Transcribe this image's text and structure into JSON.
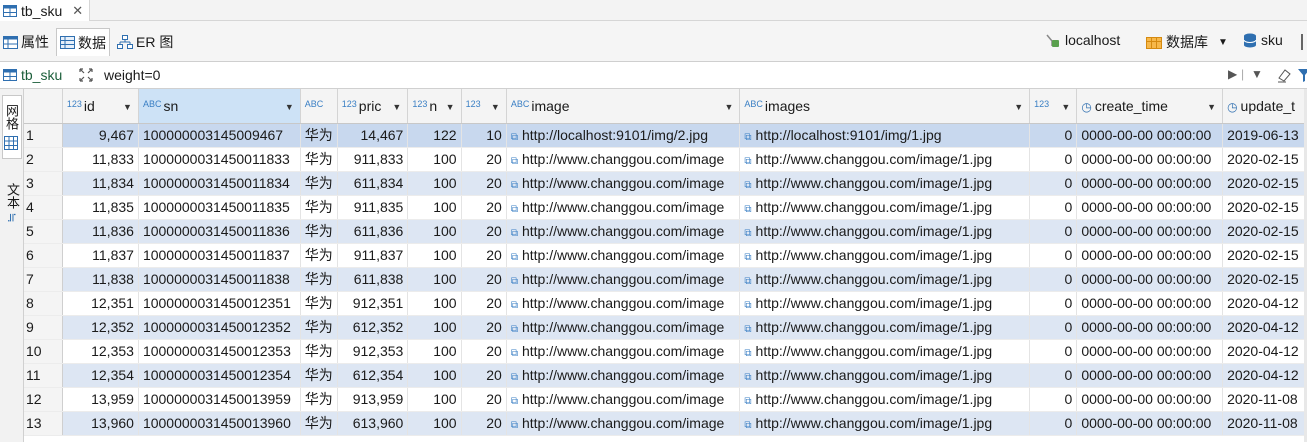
{
  "tab": {
    "title": "tb_sku",
    "close": "✕"
  },
  "subtabs": {
    "properties": "属性",
    "data": "数据",
    "er": "ER 图"
  },
  "connection": {
    "host": "localhost",
    "database_label": "数据库",
    "schema": "sku"
  },
  "filter": {
    "table": "tb_sku",
    "expression": "weight=0"
  },
  "side": {
    "panel_tab": "网格",
    "text_tab": "文本"
  },
  "columns": [
    {
      "type": "123",
      "label": "id"
    },
    {
      "type": "ABC",
      "label": "sn"
    },
    {
      "type": "ABC",
      "label": ""
    },
    {
      "type": "123",
      "label": "pric"
    },
    {
      "type": "123",
      "label": "n"
    },
    {
      "type": "123",
      "label": ""
    },
    {
      "type": "ABC",
      "label": "image"
    },
    {
      "type": "ABC",
      "label": "images"
    },
    {
      "type": "123",
      "label": ""
    },
    {
      "type": "clock",
      "label": "create_time"
    },
    {
      "type": "clock",
      "label": "update_t"
    }
  ],
  "rows": [
    {
      "n": "1",
      "id": "9,467",
      "sn": "100000003145009467",
      "name": "华为",
      "price": "14,467",
      "num": "122",
      "alert": "10",
      "image": "http://localhost:9101/img/2.jpg",
      "images": "http://localhost:9101/img/1.jpg",
      "weight": "0",
      "create": "0000-00-00 00:00:00",
      "update": "2019-06-13"
    },
    {
      "n": "2",
      "id": "11,833",
      "sn": "100000003145001183​3",
      "name": "华为",
      "price": "911,833",
      "num": "100",
      "alert": "20",
      "image": "http://www.changgou.com/image",
      "images": "http://www.changgou.com/image/1.jpg",
      "weight": "0",
      "create": "0000-00-00 00:00:00",
      "update": "2020-02-15"
    },
    {
      "n": "3",
      "id": "11,834",
      "sn": "1000000031450011834",
      "name": "华为",
      "price": "611,834",
      "num": "100",
      "alert": "20",
      "image": "http://www.changgou.com/image",
      "images": "http://www.changgou.com/image/1.jpg",
      "weight": "0",
      "create": "0000-00-00 00:00:00",
      "update": "2020-02-15"
    },
    {
      "n": "4",
      "id": "11,835",
      "sn": "1000000031450011835",
      "name": "华为",
      "price": "911,835",
      "num": "100",
      "alert": "20",
      "image": "http://www.changgou.com/image",
      "images": "http://www.changgou.com/image/1.jpg",
      "weight": "0",
      "create": "0000-00-00 00:00:00",
      "update": "2020-02-15"
    },
    {
      "n": "5",
      "id": "11,836",
      "sn": "1000000031450011836",
      "name": "华为",
      "price": "611,836",
      "num": "100",
      "alert": "20",
      "image": "http://www.changgou.com/image",
      "images": "http://www.changgou.com/image/1.jpg",
      "weight": "0",
      "create": "0000-00-00 00:00:00",
      "update": "2020-02-15"
    },
    {
      "n": "6",
      "id": "11,837",
      "sn": "1000000031450011837",
      "name": "华为",
      "price": "911,837",
      "num": "100",
      "alert": "20",
      "image": "http://www.changgou.com/image",
      "images": "http://www.changgou.com/image/1.jpg",
      "weight": "0",
      "create": "0000-00-00 00:00:00",
      "update": "2020-02-15"
    },
    {
      "n": "7",
      "id": "11,838",
      "sn": "1000000031450011838",
      "name": "华为",
      "price": "611,838",
      "num": "100",
      "alert": "20",
      "image": "http://www.changgou.com/image",
      "images": "http://www.changgou.com/image/1.jpg",
      "weight": "0",
      "create": "0000-00-00 00:00:00",
      "update": "2020-02-15"
    },
    {
      "n": "8",
      "id": "12,351",
      "sn": "1000000031450012351",
      "name": "华为",
      "price": "912,351",
      "num": "100",
      "alert": "20",
      "image": "http://www.changgou.com/image",
      "images": "http://www.changgou.com/image/1.jpg",
      "weight": "0",
      "create": "0000-00-00 00:00:00",
      "update": "2020-04-12"
    },
    {
      "n": "9",
      "id": "12,352",
      "sn": "1000000031450012352",
      "name": "华为",
      "price": "612,352",
      "num": "100",
      "alert": "20",
      "image": "http://www.changgou.com/image",
      "images": "http://www.changgou.com/image/1.jpg",
      "weight": "0",
      "create": "0000-00-00 00:00:00",
      "update": "2020-04-12"
    },
    {
      "n": "10",
      "id": "12,353",
      "sn": "1000000031450012353",
      "name": "华为",
      "price": "912,353",
      "num": "100",
      "alert": "20",
      "image": "http://www.changgou.com/image",
      "images": "http://www.changgou.com/image/1.jpg",
      "weight": "0",
      "create": "0000-00-00 00:00:00",
      "update": "2020-04-12"
    },
    {
      "n": "11",
      "id": "12,354",
      "sn": "1000000031450012354",
      "name": "华为",
      "price": "612,354",
      "num": "100",
      "alert": "20",
      "image": "http://www.changgou.com/image",
      "images": "http://www.changgou.com/image/1.jpg",
      "weight": "0",
      "create": "0000-00-00 00:00:00",
      "update": "2020-04-12"
    },
    {
      "n": "12",
      "id": "13,959",
      "sn": "1000000031450013959",
      "name": "华为",
      "price": "913,959",
      "num": "100",
      "alert": "20",
      "image": "http://www.changgou.com/image",
      "images": "http://www.changgou.com/image/1.jpg",
      "weight": "0",
      "create": "0000-00-00 00:00:00",
      "update": "2020-11-08"
    },
    {
      "n": "13",
      "id": "13,960",
      "sn": "1000000031450013960",
      "name": "华为",
      "price": "613,960",
      "num": "100",
      "alert": "20",
      "image": "http://www.changgou.com/image",
      "images": "http://www.changgou.com/image/1.jpg",
      "weight": "0",
      "create": "0000-00-00 00:00:00",
      "update": "2020-11-08"
    }
  ],
  "colors": {
    "header_selected": "#cde2f6",
    "row_alt": "#dde6f3",
    "row_first": "#c8d8ee",
    "accent": "#3a7fc4"
  }
}
